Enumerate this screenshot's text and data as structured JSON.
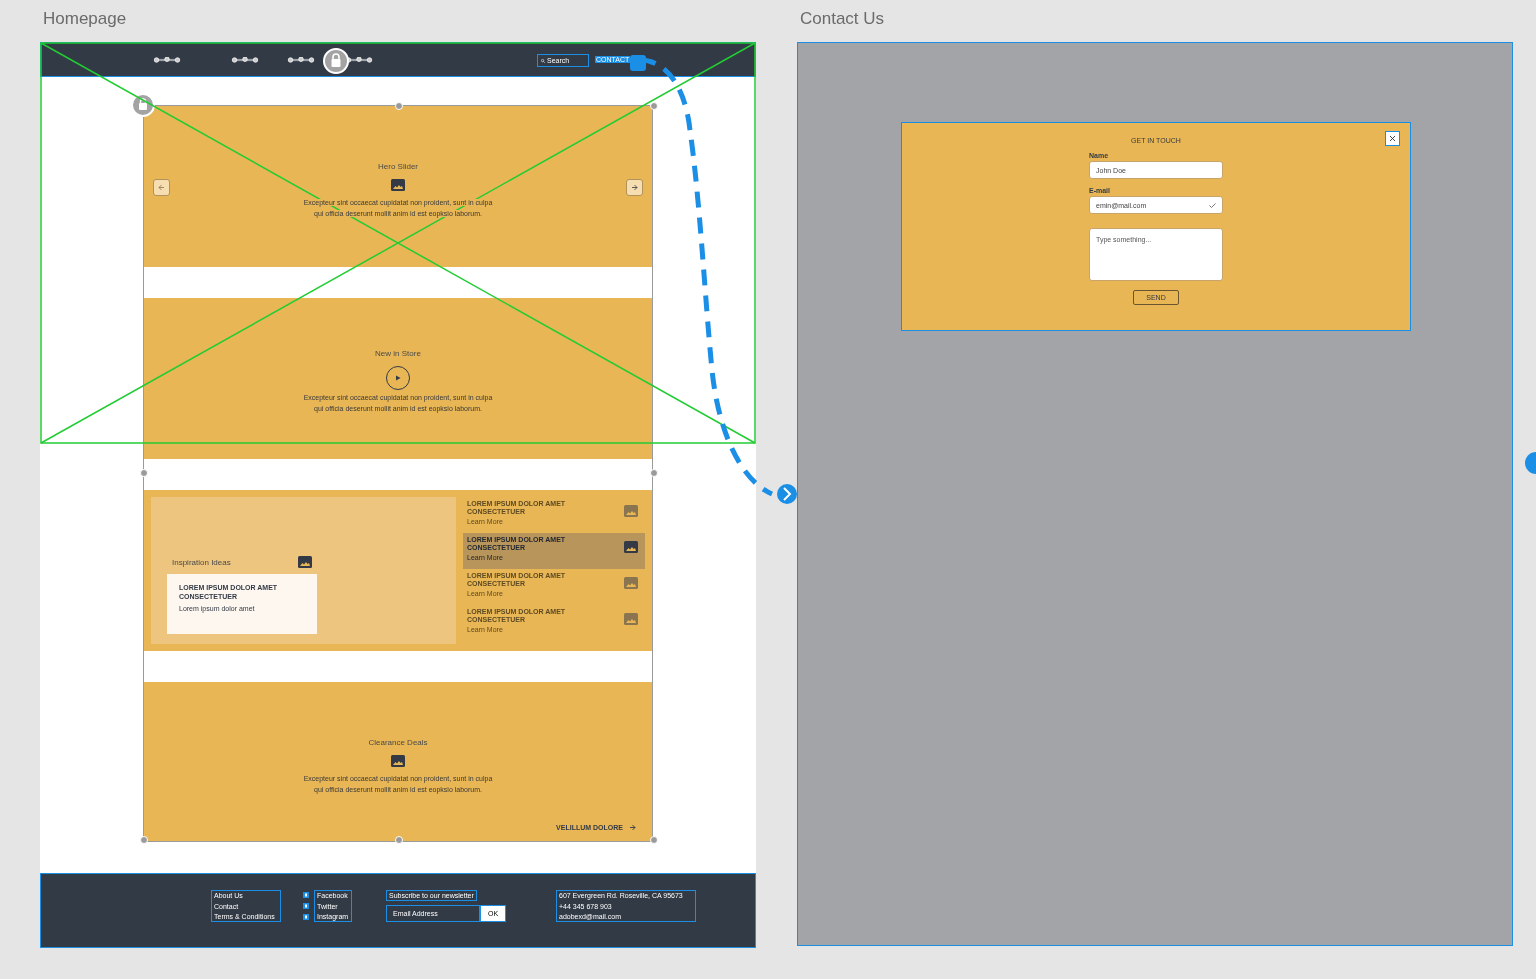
{
  "homepage": {
    "title": "Homepage",
    "nav": {
      "search": {
        "placeholder": "Search"
      },
      "contact_link": "CONTACT"
    },
    "hero": {
      "title": "Hero Slider",
      "text_lines": [
        "Excepteur sint occaecat cupidatat non proident, sunt in culpa",
        "qui officia deserunt mollit anim id est eopksio laborum."
      ]
    },
    "new_in_store": {
      "title": "New in Store",
      "text_lines": [
        "Excepteur sint occaecat cupidatat non proident, sunt in culpa",
        "qui officia deserunt mollit anim id est eopksio laborum."
      ]
    },
    "inspiration": {
      "title": "Inspiration Ideas",
      "card": {
        "heading": "LOREM IPSUM DOLOR AMET CONSECTETUER",
        "text": "Lorem ipsum dolor amet"
      },
      "items": [
        {
          "heading": "LOREM IPSUM DOLOR AMET CONSECTETUER",
          "link": "Learn More",
          "selected": false
        },
        {
          "heading": "LOREM IPSUM DOLOR AMET CONSECTETUER",
          "link": "Learn More",
          "selected": true
        },
        {
          "heading": "LOREM IPSUM DOLOR AMET CONSECTETUER",
          "link": "Learn More",
          "selected": false
        },
        {
          "heading": "LOREM IPSUM DOLOR AMET CONSECTETUER",
          "link": "Learn More",
          "selected": false
        }
      ]
    },
    "clearance": {
      "title": "Clearance Deals",
      "text_lines": [
        "Excepteur sint occaecat cupidatat non proident, sunt in culpa",
        "qui officia deserunt mollit anim id est eopksio laborum."
      ],
      "link": "VELILLUM DOLORE"
    },
    "footer": {
      "links": [
        "About Us",
        "Contact",
        "Terms & Conditions"
      ],
      "social": [
        "Facebook",
        "Twitter",
        "Instagram"
      ],
      "newsletter": {
        "label": "Subscribe to our newsletter",
        "placeholder": "Email Address",
        "button": "OK"
      },
      "address_lines": [
        "607 Evergreen Rd. Roseville, CA 95673",
        "+44 345 678 903",
        "adobexd@mail.com"
      ]
    }
  },
  "contact": {
    "title": "Contact Us",
    "form": {
      "heading": "GET IN TOUCH",
      "fields": [
        {
          "label": "Name",
          "value": "John Doe",
          "valid": false
        },
        {
          "label": "E-mail",
          "value": "emin@mail.com",
          "valid": true
        }
      ],
      "message": {
        "placeholder": "Type something..."
      },
      "button": "SEND"
    }
  }
}
